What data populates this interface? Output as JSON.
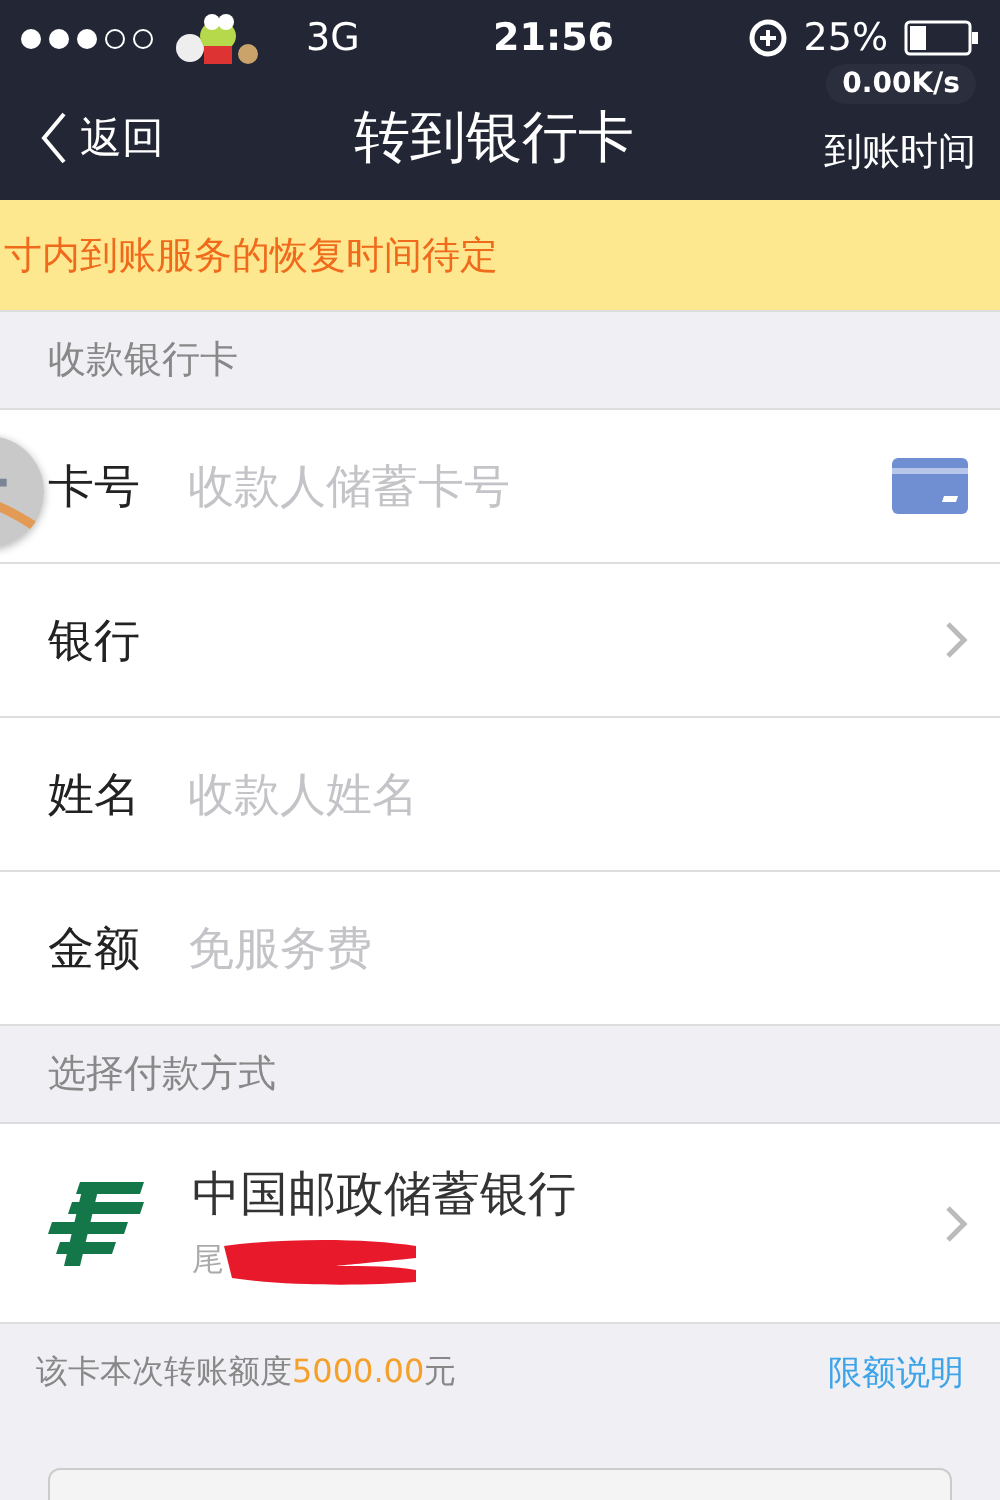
{
  "status_bar": {
    "network": "3G",
    "time": "21:56",
    "battery": "25%",
    "speed": "0.00K/s"
  },
  "nav": {
    "back": "返回",
    "title": "转到银行卡",
    "action": "到账时间"
  },
  "notice": "寸内到账服务的恢复时间待定",
  "card_section": {
    "header": "收款银行卡",
    "rows": [
      {
        "kind": "input",
        "label": "卡号",
        "placeholder": "收款人储蓄卡号",
        "card_icon": true
      },
      {
        "kind": "select",
        "label": "银行"
      },
      {
        "kind": "input",
        "label": "姓名",
        "placeholder": "收款人姓名"
      },
      {
        "kind": "input",
        "label": "金额",
        "placeholder": "免服务费"
      }
    ]
  },
  "payment_section": {
    "header": "选择付款方式",
    "bank": {
      "name": "中国邮政储蓄银行",
      "tail": "尾"
    }
  },
  "limit": {
    "prefix": "该卡本次转账额度",
    "amount": "5000.00",
    "suffix": "元",
    "link": "限额说明"
  }
}
